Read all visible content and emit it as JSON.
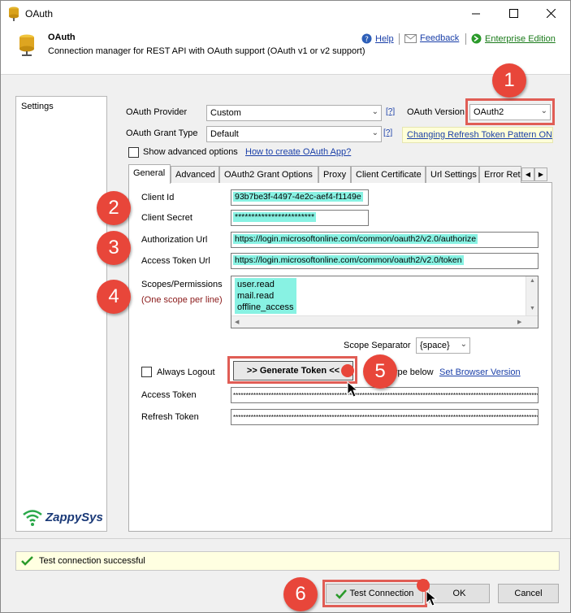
{
  "window": {
    "title": "OAuth"
  },
  "header": {
    "title": "OAuth",
    "subtitle": "Connection manager for REST API with OAuth support (OAuth v1 or v2 support)",
    "help": "Help",
    "feedback": "Feedback",
    "enterprise": "Enterprise Edition"
  },
  "sidebar": {
    "items": [
      {
        "label": "Settings"
      }
    ],
    "logo": "ZappySys"
  },
  "form": {
    "provider_label": "OAuth Provider",
    "provider_value": "Custom",
    "grant_label": "OAuth Grant Type",
    "grant_value": "Default",
    "help_q": "[?]",
    "version_label": "OAuth Version",
    "version_value": "OAuth2",
    "refresh_link": "Changing Refresh Token Pattern ON",
    "advanced_label": "Show advanced options",
    "howto_link": "How to create OAuth App?"
  },
  "tabs": [
    "General",
    "Advanced",
    "OAuth2 Grant Options",
    "Proxy",
    "Client Certificate",
    "Url Settings",
    "Error Ret"
  ],
  "general": {
    "client_id_label": "Client Id",
    "client_id_value": "93b7be3f-4497-4e2c-aef4-f1149e",
    "client_secret_label": "Client Secret",
    "client_secret_value": "************************",
    "auth_url_label": "Authorization Url",
    "auth_url_value": "https://login.microsoftonline.com/common/oauth2/v2.0/authorize",
    "token_url_label": "Access Token Url",
    "token_url_value": "https://login.microsoftonline.com/common/oauth2/v2.0/token",
    "scopes_label": "Scopes/Permissions",
    "scopes_hint": "(One scope per line)",
    "scopes": [
      "user.read",
      "mail.read",
      "offline_access"
    ],
    "separator_label": "Scope Separator",
    "separator_value": "{space}",
    "always_logout_label": "Always Logout",
    "generate_button": ">> Generate Token <<",
    "browser_text": "ype below",
    "browser_link": "Set Browser Version",
    "access_token_label": "Access Token",
    "access_token_value": "****************************************************************************************************************************",
    "refresh_token_label": "Refresh Token",
    "refresh_token_value": "****************************************************************************************************************************"
  },
  "status": {
    "message": "Test connection successful"
  },
  "buttons": {
    "test": "Test Connection",
    "ok": "OK",
    "cancel": "Cancel"
  },
  "callouts": [
    "1",
    "2",
    "3",
    "4",
    "5",
    "6"
  ],
  "colors": {
    "callout": "#e8463a",
    "highlight": "#88f2e3",
    "link": "#1a3fa8",
    "enterprise": "#1a7a1a"
  }
}
